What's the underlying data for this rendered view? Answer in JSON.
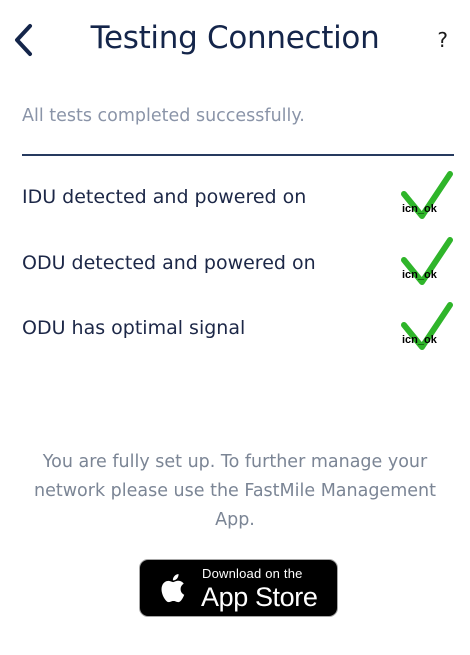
{
  "header": {
    "title": "Testing Connection",
    "back_icon": "chevron-left-icon",
    "help_label": "?"
  },
  "status_text": "All tests completed successfully.",
  "tests": [
    {
      "label": "IDU detected and powered on",
      "icon": "check-icon",
      "icon_caption": "icn_ok"
    },
    {
      "label": "ODU detected and powered on",
      "icon": "check-icon",
      "icon_caption": "icn_ok"
    },
    {
      "label": "ODU has optimal signal",
      "icon": "check-icon",
      "icon_caption": "icn_ok"
    }
  ],
  "footer_text": "You are fully set up. To further manage your network please use the FastMile Management App.",
  "app_store_badge": {
    "small_text": "Download on the",
    "large_text": "App Store",
    "icon": "apple-logo-icon"
  },
  "colors": {
    "title": "#14254a",
    "check": "#2fb52a",
    "divider": "#263a5f",
    "muted_text": "#8a94a8"
  }
}
